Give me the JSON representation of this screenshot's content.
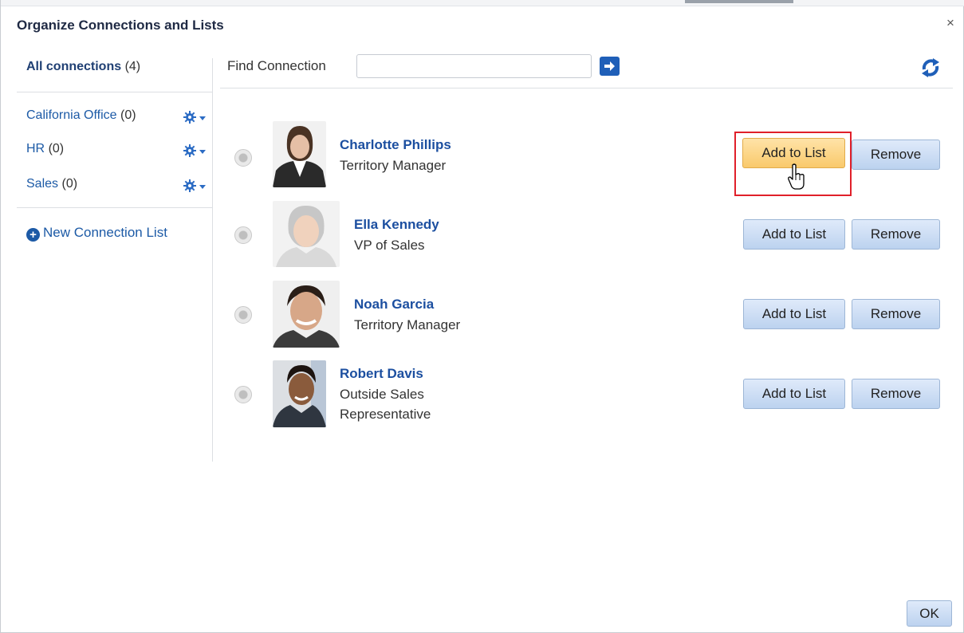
{
  "dialog": {
    "title": "Organize Connections and Lists",
    "close_glyph": "×",
    "ok_label": "OK"
  },
  "sidebar": {
    "all_connections": {
      "label": "All connections",
      "count": "(4)"
    },
    "lists": [
      {
        "label": "California Office",
        "count": "(0)",
        "icon": "gear-dropdown-icon"
      },
      {
        "label": "HR",
        "count": "(0)",
        "icon": "gear-dropdown-icon"
      },
      {
        "label": "Sales",
        "count": "(0)",
        "icon": "gear-dropdown-icon"
      }
    ],
    "new_list_label": "New Connection List",
    "new_list_icon": "plus-circle-icon"
  },
  "search": {
    "label": "Find Connection",
    "value": "",
    "placeholder": "",
    "go_icon": "arrow-right-icon",
    "refresh_icon": "refresh-icon"
  },
  "connections": [
    {
      "name": "Charlotte Phillips",
      "role_lines": [
        "Territory Manager"
      ],
      "add_label": "Add to List",
      "remove_label": "Remove",
      "highlighted": true
    },
    {
      "name": "Ella Kennedy",
      "role_lines": [
        "VP of Sales"
      ],
      "add_label": "Add to List",
      "remove_label": "Remove",
      "highlighted": false
    },
    {
      "name": "Noah Garcia",
      "role_lines": [
        "Territory Manager"
      ],
      "add_label": "Add to List",
      "remove_label": "Remove",
      "highlighted": false
    },
    {
      "name": "Robert Davis",
      "role_lines": [
        "Outside Sales",
        "Representative"
      ],
      "add_label": "Add to List",
      "remove_label": "Remove",
      "highlighted": false
    }
  ],
  "colors": {
    "link": "#1c4fa0",
    "button_bg": "#c9dcf4",
    "button_hover_bg": "#f9c96b",
    "highlight_border": "#e0202a"
  }
}
